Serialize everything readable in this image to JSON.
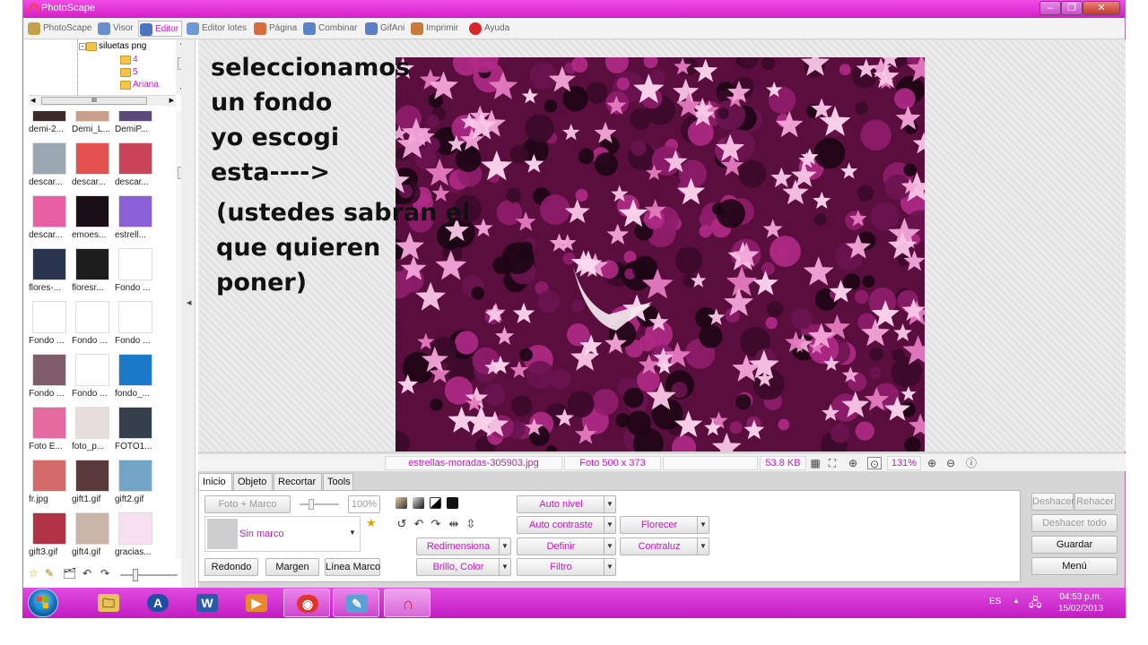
{
  "window": {
    "title": "PhotoScape",
    "controls": {
      "minimize": "–",
      "maximize": "❐",
      "close": "✕"
    }
  },
  "menu": {
    "tabs": [
      {
        "label": "PhotoScape",
        "icon": "photoscape-icon",
        "color": "#c3a14b"
      },
      {
        "label": "Visor",
        "icon": "viewer-icon",
        "color": "#6b8ecf"
      },
      {
        "label": "Editor",
        "icon": "editor-icon",
        "color": "#4a75c1",
        "active": true
      },
      {
        "label": "Editor lotes",
        "icon": "batch-editor-icon",
        "color": "#6f9ad6"
      },
      {
        "label": "Página",
        "icon": "page-icon",
        "color": "#d86c3c"
      },
      {
        "label": "Combinar",
        "icon": "combine-icon",
        "color": "#5985c8"
      },
      {
        "label": "GifAni",
        "icon": "gif-animation-icon",
        "color": "#5e7fc4"
      },
      {
        "label": "Imprimir",
        "icon": "print-icon",
        "color": "#c87a3b"
      },
      {
        "label": "Ayuda",
        "icon": "help-icon",
        "color": "#d8242a"
      }
    ]
  },
  "tree": {
    "folder": "siluetas png",
    "subfolders": [
      "4",
      "5",
      "Ariana"
    ],
    "hscroll_glyph": "III"
  },
  "thumbnails": [
    {
      "name": "demi-2...",
      "color": "#3a2a2a"
    },
    {
      "name": "Demi_L...",
      "color": "#c9a08a"
    },
    {
      "name": "DemiP...",
      "color": "#5b4b7a"
    },
    {
      "name": "descar...",
      "color": "#9ba7b1"
    },
    {
      "name": "descar...",
      "color": "#e4514f"
    },
    {
      "name": "descar...",
      "color": "#c94459"
    },
    {
      "name": "descar...",
      "color": "#e85fa3"
    },
    {
      "name": "emoes...",
      "color": "#1a0f16"
    },
    {
      "name": "estrell...",
      "color": "#8a5fd8"
    },
    {
      "name": "flores-...",
      "color": "#2a3550"
    },
    {
      "name": "floresr...",
      "color": "#1d1d1d"
    },
    {
      "name": "Fondo ...",
      "color": "#ffffff"
    },
    {
      "name": "Fondo ...",
      "color": "#ffffff"
    },
    {
      "name": "Fondo ...",
      "color": "#ffffff"
    },
    {
      "name": "Fondo ...",
      "color": "#ffffff"
    },
    {
      "name": "Fondo ...",
      "color": "#7e5c6a"
    },
    {
      "name": "Fondo ...",
      "color": "#ffffff"
    },
    {
      "name": "fondo_...",
      "color": "#1b79c9"
    },
    {
      "name": "Foto E...",
      "color": "#e56aa0"
    },
    {
      "name": "foto_p...",
      "color": "#e8dede"
    },
    {
      "name": "FOTO1...",
      "color": "#35404a"
    },
    {
      "name": "fr.jpg",
      "color": "#d46a6a"
    },
    {
      "name": "gift1.gif",
      "color": "#5a3a3a"
    },
    {
      "name": "gift2.gif",
      "color": "#72a6c6"
    },
    {
      "name": "gift3.gif",
      "color": "#b23346"
    },
    {
      "name": "gift4.gif",
      "color": "#c9b6a8"
    },
    {
      "name": "gracias...",
      "color": "#f6e0f2"
    }
  ],
  "bottom_tools": [
    "☆",
    "✎",
    "🗂",
    "↶",
    "↷"
  ],
  "overlay": {
    "lines": [
      "seleccionamos",
      "un fondo",
      "yo escogi",
      "esta---->"
    ],
    "lines2": [
      "(ustedes sabran el",
      "que quieren",
      "poner)"
    ]
  },
  "status": {
    "filename": "estrellas-moradas-305903.jpg",
    "dimensions": "Foto 500 x 373",
    "filesize": "53.8 KB",
    "zoom": "131%"
  },
  "edit_tabs": [
    "Inicio",
    "Objeto",
    "Recortar",
    "Tools"
  ],
  "panel": {
    "photo_frame": "Foto + Marco",
    "percent": "100%",
    "frame_select": "Sin marco",
    "round": "Redondo",
    "margin": "Margen",
    "frame_line": "Línea Marco",
    "resize": "Redimensiona",
    "brightness": "Brillo, Color",
    "auto_level": "Auto nivel",
    "auto_contrast": "Auto contraste",
    "sharpen": "Definir",
    "filter": "Filtro",
    "bloom": "Florecer",
    "backlight": "Contraluz"
  },
  "side_buttons": {
    "undo": "Deshacer",
    "redo": "Rehacer",
    "undo_all": "Deshacer todo",
    "save": "Guardar",
    "menu": "Menú"
  },
  "taskbar": {
    "apps": [
      {
        "name": "explorer-icon",
        "glyph": "🗀",
        "color": "#e9c25b"
      },
      {
        "name": "avast-icon",
        "glyph": "A",
        "color": "#1f4fa3"
      },
      {
        "name": "word-icon",
        "glyph": "W",
        "color": "#2c5aa8"
      },
      {
        "name": "media-player-icon",
        "glyph": "▶",
        "color": "#e88a2a"
      },
      {
        "name": "chrome-icon",
        "glyph": "◉",
        "color": "#e0332a"
      },
      {
        "name": "paint-icon",
        "glyph": "✎",
        "color": "#5aa0d8"
      },
      {
        "name": "photoscape-taskbar-icon",
        "glyph": "∩",
        "color": "#d21fc7"
      }
    ],
    "lang": "ES",
    "time": "04:53 p.m.",
    "date": "15/02/2013"
  }
}
